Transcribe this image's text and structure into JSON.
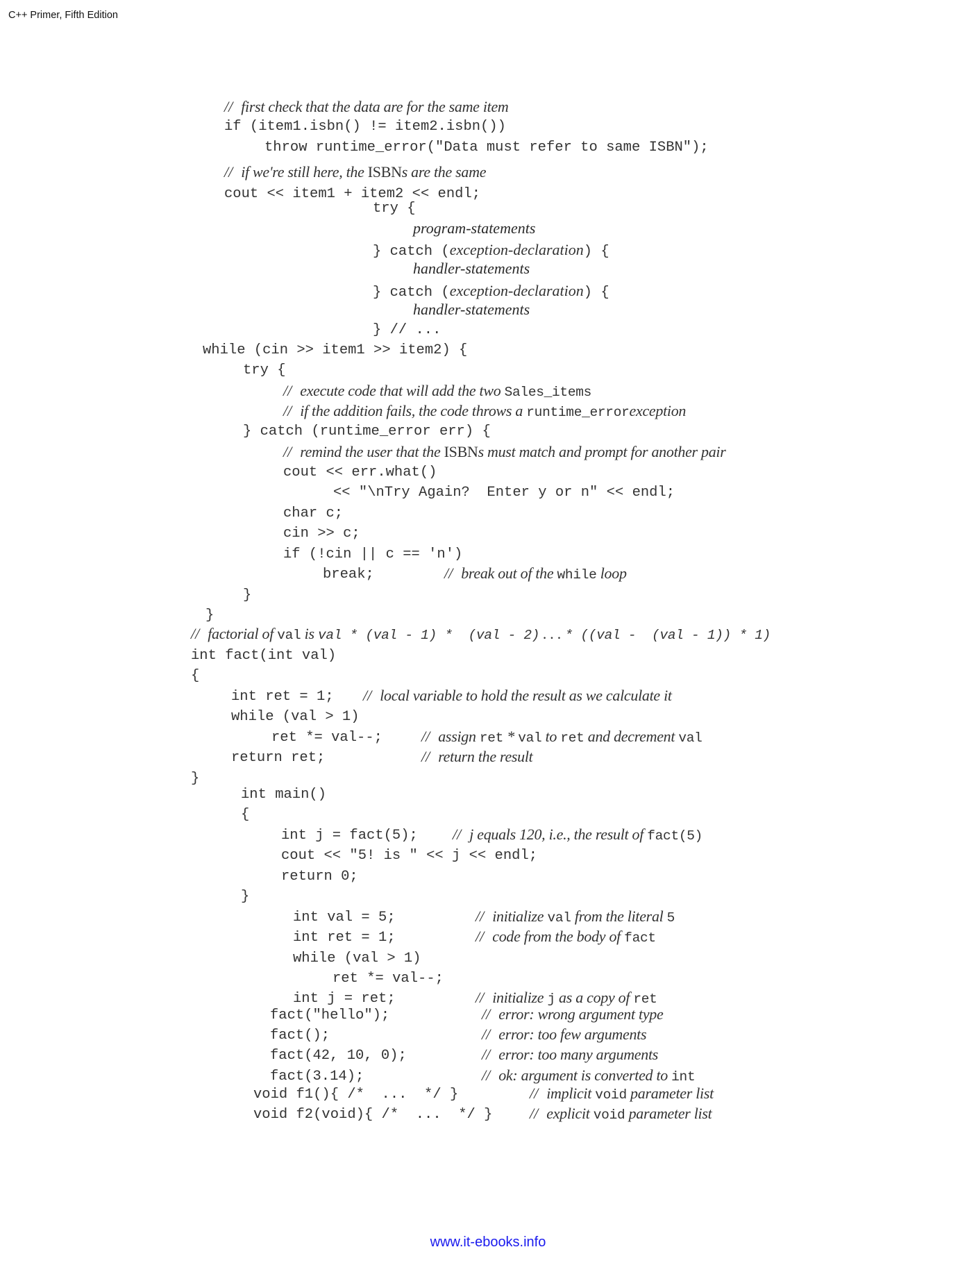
{
  "header": {
    "title": "C++ Primer, Fifth Edition"
  },
  "footer": {
    "link_text": "www.it-ebooks.info"
  },
  "snippets": {
    "isbn_check": {
      "comment1": "first check that the data are for the same item",
      "if_line": "if (item1.isbn() != item2.isbn())",
      "throw_line": "throw runtime_error(\"Data must refer to same ISBN\");",
      "comment2_pre": "if we're still here, the ",
      "comment2_isbn": "ISBN",
      "comment2_post": "s are the same",
      "cout_line": "cout << item1 + item2 << endl;"
    },
    "try_syntax": {
      "try_line": "try {",
      "program_statements": "program-statements",
      "catch_prefix": "} catch (",
      "exception_declaration": "exception-declaration",
      "catch_suffix": ") {",
      "handler_statements": "handler-statements",
      "end_line": "} // ..."
    },
    "while_loop": {
      "while_line": "while (cin >> item1 >> item2) {",
      "try_line": "try {",
      "comment1_pre": "execute code that will add the two ",
      "comment1_code": "Sales_items",
      "comment2_pre": "if the addition fails, the code throws a ",
      "comment2_code": "runtime_error",
      "comment2_post": "exception",
      "catch_line": "} catch (runtime_error err) {",
      "comment3_pre": "remind the user that the ",
      "comment3_isbn": "ISBN",
      "comment3_post": "s must match and prompt for another pair",
      "cout_line": "cout << err.what()",
      "cout_cont": "<< \"\\nTry Again?  Enter y or n\" << endl;",
      "char_line": "char c;",
      "cin_line": "cin >> c;",
      "if_line": "if (!cin || c == 'n')",
      "break_line": "break;",
      "break_comment_pre": "break out of the ",
      "break_comment_code": "while",
      "break_comment_post": " loop",
      "close_inner": "}",
      "close_outer": "}"
    },
    "fact_def": {
      "comment_pre": "factorial of ",
      "comment_code1": "val",
      "comment_mid": " is ",
      "comment_code2": "val * (val - 1) *  (val - 2)",
      "comment_dots": " . . . ",
      "comment_code3": "* ((val -  (val - 1)) * 1)",
      "sig_line": "int fact(int val)",
      "open_brace": "{",
      "ret_line": "int ret = 1;",
      "ret_comment": "local variable to hold the result as we calculate it",
      "while_line": "while (val > 1)",
      "mul_line": "ret *= val--;",
      "mul_comment_pre": "assign ",
      "mul_comment_code1": "ret",
      "mul_comment_star": " * ",
      "mul_comment_code2": "val",
      "mul_comment_mid": " to ",
      "mul_comment_code3": "ret",
      "mul_comment_post": " and decrement ",
      "mul_comment_code4": "val",
      "return_line": "return ret;",
      "return_comment": "return the result",
      "close_brace": "}"
    },
    "main_def": {
      "sig_line": "int main()",
      "open_brace": "{",
      "j_line": "int j = fact(5);",
      "j_comment_pre": "j",
      "j_comment_mid": " equals 120, i.e., the result of ",
      "j_comment_code": "fact(5)",
      "cout_line": "cout << \"5! is \" << j << endl;",
      "return_line": "return 0;",
      "close_brace": "}"
    },
    "inline_equiv": {
      "val_line": "int val = 5;",
      "val_comment_pre": "initialize ",
      "val_comment_code": "val",
      "val_comment_post": " from the literal ",
      "val_comment_lit": "5",
      "ret_line": "int ret = 1;",
      "ret_comment_pre": "code from the body of ",
      "ret_comment_code": "fact",
      "while_line": "while (val > 1)",
      "mul_line": "ret *= val--;",
      "j_line": "int j = ret;",
      "j_comment_pre": "initialize ",
      "j_comment_code1": "j",
      "j_comment_mid": " as a copy of ",
      "j_comment_code2": "ret"
    },
    "bad_calls": [
      {
        "code": "fact(\"hello\");",
        "comment": "error: wrong argument type",
        "comment_code": ""
      },
      {
        "code": "fact();",
        "comment": "error: too few arguments",
        "comment_code": ""
      },
      {
        "code": "fact(42, 10, 0);",
        "comment": "error: too many arguments",
        "comment_code": ""
      },
      {
        "code": "fact(3.14);",
        "comment": "ok: argument is converted to ",
        "comment_code": "int"
      }
    ],
    "void_params": [
      {
        "code": "void f1(){ /*  ...  */ }",
        "comment_pre": "implicit ",
        "comment_code": "void",
        "comment_post": " parameter list"
      },
      {
        "code": "void f2(void){ /*  ...  */ }",
        "comment_pre": "explicit ",
        "comment_code": "void",
        "comment_post": " parameter list"
      }
    ],
    "comment_marker": "//"
  }
}
